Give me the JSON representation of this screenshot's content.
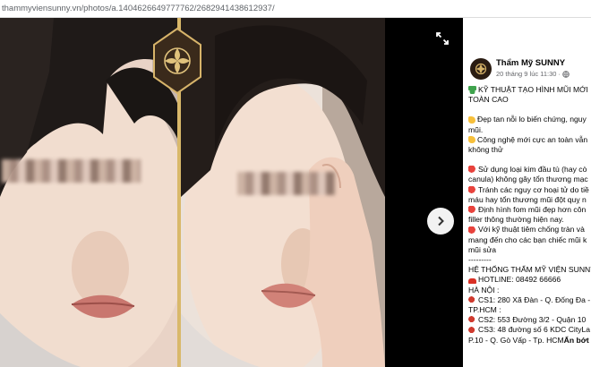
{
  "browser": {
    "url": "thammyviensunny.vn/photos/a.1404626649777762/2682941438612937/"
  },
  "viewer": {
    "expand_icon": "expand-arrows-icon",
    "next_icon": "chevron-right-icon",
    "watermark_icon": "lotus-logo"
  },
  "post": {
    "page_name": "Thẩm Mỹ SUNNY",
    "timestamp": "20 tháng 9 lúc 11:30",
    "privacy_icon": "globe-icon",
    "lines": [
      {
        "icon": "clover",
        "text": "KỸ THUẬT TẠO HÌNH MŨI MỚI",
        "bold": false
      },
      {
        "icon": "",
        "text": "TOÀN CAO",
        "bold": false
      },
      {
        "gap": true
      },
      {
        "icon": "thumb",
        "text": "Đẹp tan nỗi lo biến chứng, nguy",
        "bold": false
      },
      {
        "icon": "",
        "text": "mũi.",
        "bold": false
      },
      {
        "icon": "thumb",
        "text": "Công nghệ mới cực an toàn vẫn",
        "bold": false
      },
      {
        "icon": "",
        "text": "không thử",
        "bold": false
      },
      {
        "gap": true
      },
      {
        "icon": "pin",
        "text": "Sử dụng loại kim đầu tù (hay cò",
        "bold": false
      },
      {
        "icon": "",
        "text": "canula) không gây tổn thương mạc",
        "bold": false
      },
      {
        "icon": "pin",
        "text": "Tránh các nguy cơ hoại tử do tiề",
        "bold": false
      },
      {
        "icon": "",
        "text": "máu hay tổn thương mũi đột quỵ n",
        "bold": false
      },
      {
        "icon": "pin",
        "text": "Định hình fom mũi đẹp hơn côn",
        "bold": false
      },
      {
        "icon": "",
        "text": "filler thông thường hiện nay.",
        "bold": false
      },
      {
        "icon": "pin",
        "text": "Với kỹ thuật tiêm chống tràn và",
        "bold": false
      },
      {
        "icon": "",
        "text": "mang đến cho các bạn chiếc mũi k",
        "bold": false
      },
      {
        "icon": "",
        "text": "mũi sửa",
        "bold": false
      },
      {
        "icon": "",
        "text": "---------",
        "bold": false
      },
      {
        "icon": "",
        "text": "HỆ THỐNG THẨM MỸ VIỆN SUNNY",
        "bold": false
      },
      {
        "icon": "phone",
        "text": "HOTLINE: 08492 66666",
        "bold": false
      },
      {
        "icon": "",
        "text": "HÀ NỘI :",
        "bold": false
      },
      {
        "icon": "pin2",
        "text": "CS1: 280 Xã Đàn - Q. Đống Đa -",
        "bold": false
      },
      {
        "icon": "",
        "text": "TP.HCM :",
        "bold": false
      },
      {
        "icon": "pin2",
        "text": "CS2: 553 Đường 3/2 - Quận 10",
        "bold": false
      },
      {
        "icon": "pin2",
        "text": "CS3: 48 đường số 6 KDC CityLa",
        "bold": false
      },
      {
        "icon": "",
        "text": "P.10 - Q. Gò Vấp - Tp. HCM ",
        "bold": false,
        "tail": "Ẩn bớt"
      }
    ]
  }
}
